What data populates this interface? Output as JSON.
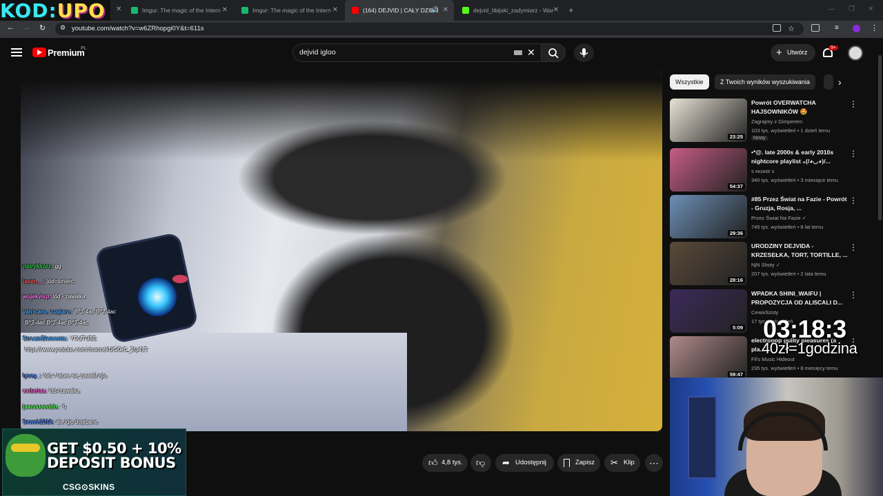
{
  "browser": {
    "tabs": [
      {
        "title": "Imgur: The magic of the Intern",
        "color": "#1bb76e"
      },
      {
        "title": "Imgur: The magic of the Intern",
        "color": "#1bb76e"
      },
      {
        "title": "(164) DEJVID | CAŁY DZIEŃ",
        "color": "#ff0000"
      },
      {
        "title": "dejvid_tibijski_zadymiarz - War",
        "color": "#53fc18"
      }
    ],
    "url": "youtube.com/watch?v=w6ZRhopgi0Y&t=611s"
  },
  "overlay_logo": {
    "part1": "KOD:",
    "part2": "UPO"
  },
  "youtube": {
    "brand": "Premium",
    "region": "PL",
    "search_value": "dejvid igloo",
    "create_label": "Utwórz",
    "notification_count": "9+"
  },
  "chat": [
    {
      "user": "patrykkzez:",
      "msg": "gg",
      "color": "#27c93f"
    },
    {
      "user": "laven__:",
      "msg": "lód=śmierć",
      "color": "#ff5a5a"
    },
    {
      "user": "wujekvisp:",
      "msg": "lód - zawalka",
      "color": "#ff7cf0"
    },
    {
      "user": "vatricano_cuglaro:",
      "msg": "B^2-4ac B^2-4ac",
      "color": "#4aa8ff"
    },
    {
      "user": "",
      "msg": "B^2-4ac B^2-4ac B^2-4ac",
      "color": "#ffffff"
    },
    {
      "user": "StreamElements:",
      "msg": "YOUTUBE",
      "color": "#4aa8ff"
    },
    {
      "user": "",
      "msg": "https://www.youtube.com/channel/UCi0kC_2fp41T",
      "color": "#ffffff"
    },
    {
      "user": "lysey_:",
      "msg": "lód = łatwo się zawalił iglo",
      "color": "#4a7fff"
    },
    {
      "user": "xxdariaa:",
      "msg": "lód=zawalka",
      "color": "#ff5ad0"
    },
    {
      "user": "jaacooooobb:",
      "msg": "-0",
      "color": "#55ff55"
    },
    {
      "user": "Sewek2016:",
      "msg": "ale iglo dojebane",
      "color": "#4a7fff"
    }
  ],
  "ad": {
    "line1": "GET $0.50 + 10%",
    "line2": "DEPOSIT BONUS",
    "brand": "CSG⊙SKINS"
  },
  "actions": {
    "likes": "4,8 tys.",
    "share": "Udostępnij",
    "save": "Zapisz",
    "clip": "Klip",
    "more": "⋯"
  },
  "chips": [
    "Wszystkie",
    "Z Twoich wyników wyszukiwania"
  ],
  "recommendations": [
    {
      "title": "Powrót OVERWATCHA HAJSOWNIKÓW 🤩",
      "channel": "Zagrajmy z Gimperem",
      "meta": "103 tys. wyświetleń • 1 dzień temu",
      "duration": "23:25",
      "badge": "Nowy",
      "thumb_color": "#e9e3d6"
    },
    {
      "title": "•*@. late 2000s & early 2010s nightcore playlist ₊(/◕◡◕)/...",
      "channel": "ꜱ ᴋᴋᴜᴋɪᴇ ꜱ",
      "meta": "340 tys. wyświetleń • 3 miesiące temu",
      "duration": "54:37",
      "badge": "",
      "thumb_color": "#c75c84"
    },
    {
      "title": "#85 Przez Świat na Fazie - Powrót - Gruzja, Rosja, ...",
      "channel": "Przez Świat Na Fazie ✓",
      "meta": "745 tys. wyświetleń • 8 lat temu",
      "duration": "29:36",
      "badge": "",
      "thumb_color": "#6c8fb6"
    },
    {
      "title": "URODZINY DEJVIDA - KRZESEŁKA, TORT, TORTILLE, ...",
      "channel": "NjN Shoty ✓",
      "meta": "207 tys. wyświetleń • 2 lata temu",
      "duration": "28:16",
      "badge": "",
      "thumb_color": "#5a4a3a"
    },
    {
      "title": "WPADKA SHINI_WAIFU | PROPOZYCJA OD ALI5CALI D...",
      "channel": "CewixSzoty",
      "meta": "17 tys. wyświetleń",
      "duration": "5:09",
      "badge": "",
      "thumb_color": "#3c2a5a"
    },
    {
      "title": "electropop guilty pleasures (a pla...",
      "channel": "Fil's Music Hideout",
      "meta": "235 tys. wyświetleń • 8 miesięcy temu",
      "duration": "59:47",
      "badge": "",
      "thumb_color": "#b08a8a"
    }
  ],
  "overlay": {
    "timer": "03:18:3",
    "rate": "40zł=1godzina"
  }
}
